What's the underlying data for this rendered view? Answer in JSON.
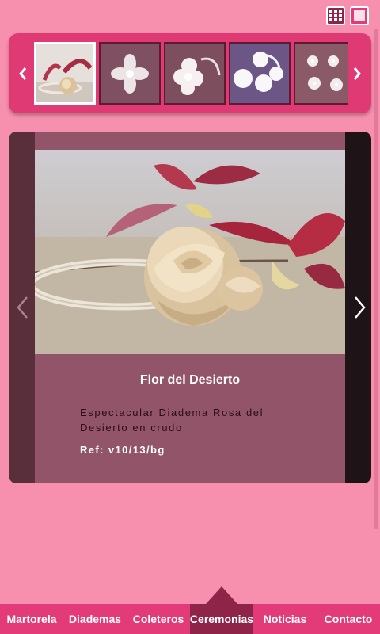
{
  "colors": {
    "background": "#f78fae",
    "accent": "#e23b78",
    "accent_dark": "#8e2447",
    "panel": "#925468"
  },
  "view_toggles": [
    {
      "icon": "grid-view-icon",
      "active": true
    },
    {
      "icon": "single-view-icon",
      "active": false
    }
  ],
  "thumbnails": {
    "prev_icon": "chevron-left-icon",
    "next_icon": "chevron-right-icon",
    "items": [
      {
        "subject": "flower headband on table",
        "active": true
      },
      {
        "subject": "white feather flower"
      },
      {
        "subject": "white flower with headband"
      },
      {
        "subject": "white pompom flowers"
      },
      {
        "subject": "small white flowers"
      }
    ]
  },
  "product": {
    "title": "Flor del Desierto",
    "description": "Espectacular Diadema Rosa del Desierto en crudo",
    "ref": "Ref: v10/13/bg",
    "prev_icon": "chevron-left-icon",
    "next_icon": "chevron-right-icon"
  },
  "nav": {
    "items": [
      {
        "label": "Martorela",
        "active": false
      },
      {
        "label": "Diademas",
        "active": false
      },
      {
        "label": "Coleteros",
        "active": false
      },
      {
        "label": "Ceremonias",
        "active": true
      },
      {
        "label": "Noticias",
        "active": false
      },
      {
        "label": "Contacto",
        "active": false
      }
    ]
  }
}
